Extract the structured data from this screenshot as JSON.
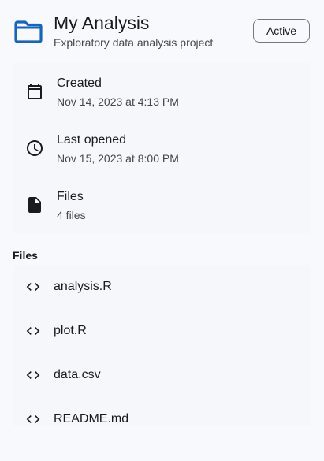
{
  "project": {
    "title": "My Analysis",
    "subtitle": "Exploratory data analysis project",
    "status": "Active",
    "folder_icon": "folder-icon",
    "accent_color": "#1565c0"
  },
  "details": [
    {
      "icon": "calendar-icon",
      "label": "Created",
      "value": "Nov 14, 2023 at 4:13 PM"
    },
    {
      "icon": "clock-icon",
      "label": "Last opened",
      "value": "Nov 15, 2023 at 8:00 PM"
    },
    {
      "icon": "file-icon",
      "label": "Files",
      "value": "4 files"
    }
  ],
  "files_section": {
    "heading": "Files",
    "items": [
      {
        "icon": "code-icon",
        "name": "analysis.R"
      },
      {
        "icon": "code-icon",
        "name": "plot.R"
      },
      {
        "icon": "code-icon",
        "name": "data.csv"
      },
      {
        "icon": "code-icon",
        "name": "README.md"
      }
    ]
  }
}
